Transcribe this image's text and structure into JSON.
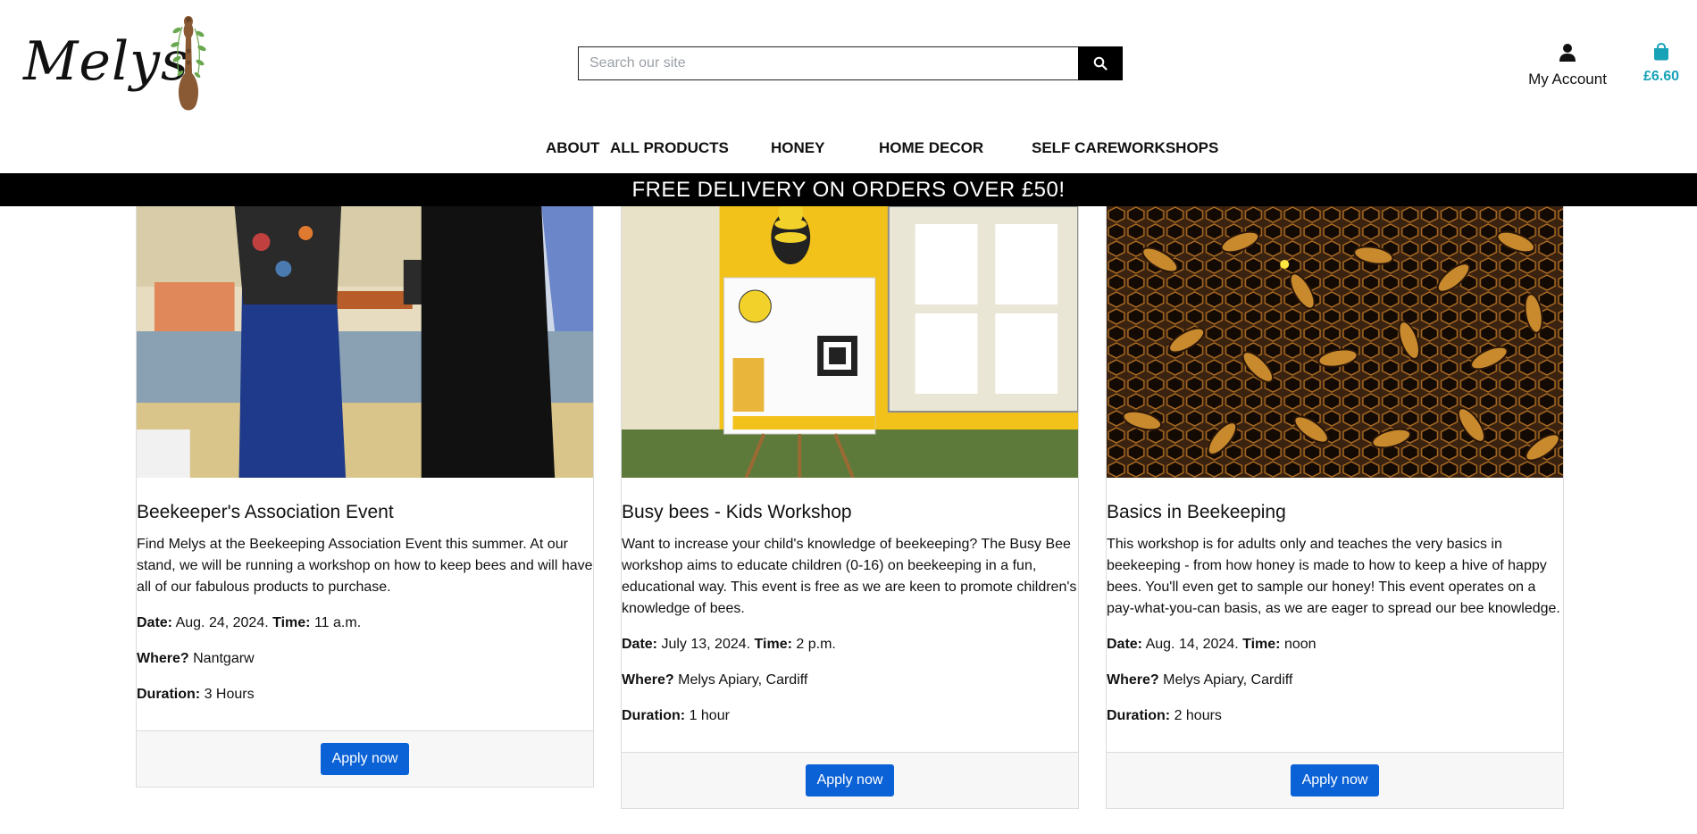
{
  "brand": {
    "logo_text": "Melys"
  },
  "search": {
    "placeholder": "Search our site"
  },
  "account": {
    "label": "My Account",
    "icon": "user-icon"
  },
  "bag": {
    "total": "£6.60",
    "icon": "shopping-bag-icon",
    "color": "#17a2b8"
  },
  "nav": {
    "items": [
      {
        "label": "ABOUT"
      },
      {
        "label": "ALL PRODUCTS"
      },
      {
        "label": "HONEY"
      },
      {
        "label": "HOME DECOR"
      },
      {
        "label": "SELF CARE"
      },
      {
        "label": "WORKSHOPS"
      }
    ]
  },
  "banner": {
    "text": "FREE DELIVERY ON ORDERS OVER £50!"
  },
  "labels": {
    "date": "Date:",
    "time": "Time:",
    "where": "Where?",
    "duration": "Duration:"
  },
  "cards": [
    {
      "title": "Beekeeper's Association Event",
      "description": "Find Melys at the Beekeeping Association Event this summer. At our stand, we will be running a workshop on how to keep bees and will have all of our fabulous products to purchase.",
      "date": "Aug. 24, 2024.",
      "time": "11 a.m.",
      "where": "Nantgarw",
      "duration": "3 Hours",
      "button": "Apply now"
    },
    {
      "title": "Busy bees - Kids Workshop",
      "description": "Want to increase your child's knowledge of beekeeping? The Busy Bee workshop aims to educate children (0-16) on beekeeping in a fun, educational way. This event is free as we are keen to promote children's knowledge of bees.",
      "date": "July 13, 2024.",
      "time": "2 p.m.",
      "where": "Melys Apiary, Cardiff",
      "duration": "1 hour",
      "button": "Apply now"
    },
    {
      "title": "Basics in Beekeeping",
      "description": "This workshop is for adults only and teaches the very basics in beekeeping - from how honey is made to how to keep a hive of happy bees. You'll even get to sample our honey! This event operates on a pay-what-you-can basis, as we are eager to spread our bee knowledge.",
      "date": "Aug. 14, 2024.",
      "time": "noon",
      "where": "Melys Apiary, Cardiff",
      "duration": "2 hours",
      "button": "Apply now"
    }
  ],
  "colors": {
    "banner_bg": "#000000",
    "button_bg": "#0b62d6",
    "footer_bg": "#f7f7f7"
  }
}
